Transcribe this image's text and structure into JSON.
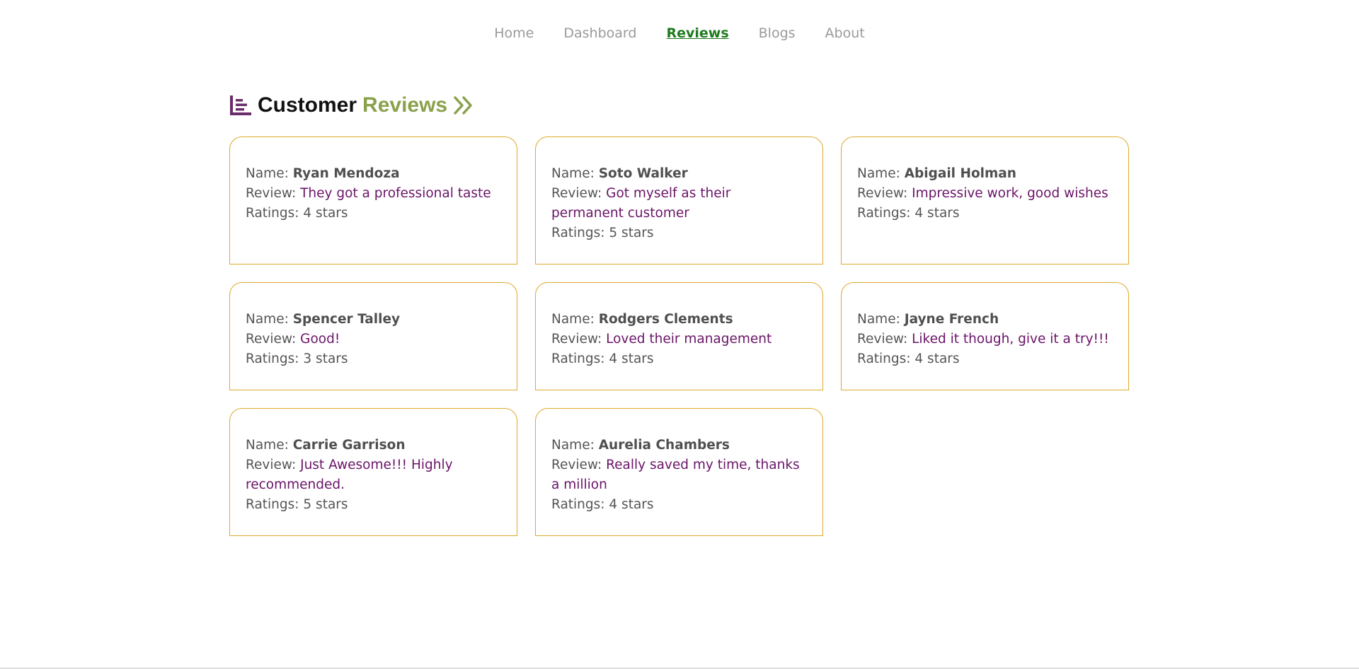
{
  "nav": {
    "items": [
      {
        "label": "Home"
      },
      {
        "label": "Dashboard"
      },
      {
        "label": "Reviews"
      },
      {
        "label": "Blogs"
      },
      {
        "label": "About"
      }
    ],
    "active": "Reviews"
  },
  "heading": {
    "word1": "Customer",
    "word2": "Reviews",
    "icons": [
      "list-icon",
      "double-chevron-right-icon"
    ]
  },
  "labels": {
    "name": "Name: ",
    "review": "Review: ",
    "ratings": "Ratings: "
  },
  "reviews": [
    {
      "name": "Ryan Mendoza",
      "review": "They got a professional taste",
      "rating": "4 stars"
    },
    {
      "name": "Soto Walker",
      "review": "Got myself as their permanent customer",
      "rating": "5 stars"
    },
    {
      "name": "Abigail Holman",
      "review": "Impressive work, good wishes",
      "rating": "4 stars"
    },
    {
      "name": "Spencer Talley",
      "review": "Good!",
      "rating": "3 stars"
    },
    {
      "name": "Rodgers Clements",
      "review": "Loved their management",
      "rating": "4 stars"
    },
    {
      "name": "Jayne French",
      "review": "Liked it though, give it a try!!!",
      "rating": "4 stars"
    },
    {
      "name": "Carrie Garrison",
      "review": "Just Awesome!!! Highly recommended.",
      "rating": "5 stars"
    },
    {
      "name": "Aurelia Chambers",
      "review": "Really saved my time, thanks a million",
      "rating": "4 stars"
    }
  ],
  "colors": {
    "accent_green": "#8aa14c",
    "nav_active": "#1f7a1f",
    "review_text": "#6a1468",
    "card_border": "#e0a82a",
    "icon_purple": "#6b2c6b"
  }
}
